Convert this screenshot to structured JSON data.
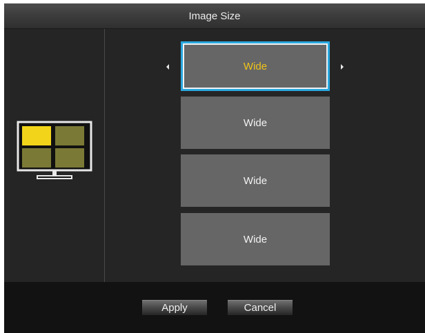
{
  "window": {
    "title": "Image Size"
  },
  "options": [
    {
      "label": "Wide",
      "selected": true
    },
    {
      "label": "Wide",
      "selected": false
    },
    {
      "label": "Wide",
      "selected": false
    },
    {
      "label": "Wide",
      "selected": false
    }
  ],
  "buttons": {
    "apply": "Apply",
    "cancel": "Cancel"
  },
  "icons": {
    "preview": "monitor-quad-layout-icon",
    "prev": "arrow-left-icon",
    "next": "arrow-right-icon"
  },
  "colors": {
    "accent_border": "#29a8e0",
    "selected_text": "#f0c419",
    "option_bg": "#666666",
    "quad_active": "#f2d51a",
    "quad_inactive": "#7a7a36"
  }
}
